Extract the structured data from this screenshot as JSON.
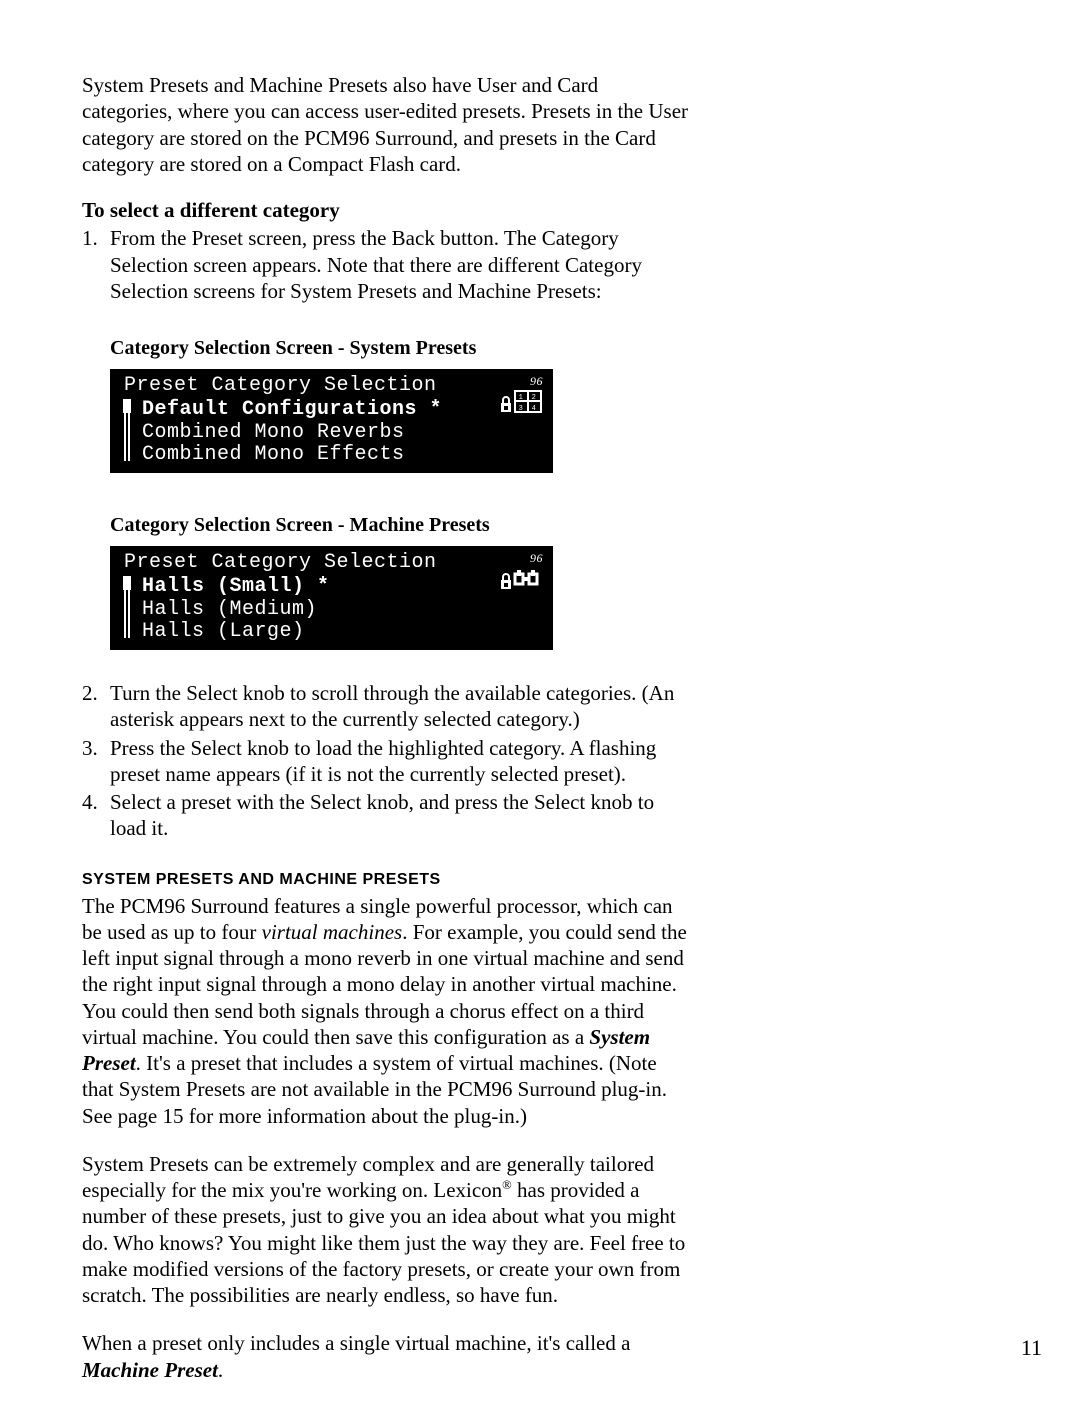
{
  "intro": "System Presets and Machine Presets also have User and Card categories, where you can access user-edited presets. Presets in the User category are stored on the PCM96 Surround, and presets in the Card category are stored on a Compact Flash card.",
  "select_heading": "To select a different category",
  "step1": "From the Preset screen, press the Back button. The Category Selection screen appears. Note that there are different Category Selection screens for System Presets and Machine Presets:",
  "label_screen1": "Category Selection Screen - System Presets",
  "lcd1": {
    "title": "Preset Category Selection",
    "row1": "Default Configurations *",
    "row2": "Combined Mono Reverbs",
    "row3": "Combined Mono Effects",
    "corner_num": "96"
  },
  "label_screen2": "Category Selection Screen - Machine Presets",
  "lcd2": {
    "title": "Preset Category Selection",
    "row1": "Halls (Small) *",
    "row2": "Halls (Medium)",
    "row3": "Halls (Large)",
    "corner_num": "96"
  },
  "step2": "Turn the Select knob to scroll through the available categories. (An asterisk appears next to the currently selected category.)",
  "step3": "Press the Select knob to load the highlighted category. A flashing preset name appears (if it is not the currently selected preset).",
  "step4": "Select a preset with the Select knob, and press the Select knob to load it.",
  "section_title": "SYSTEM PRESETS AND MACHINE PRESETS",
  "body1_a": "The PCM96 Surround features a single powerful processor, which can be used as up to four ",
  "body1_ital": "virtual machines",
  "body1_b": ". For example, you could send the left input signal through a mono reverb in one virtual machine and send the right input signal through a mono delay in another virtual machine. You could then send both signals through a chorus effect on a third virtual machine. You could then save this configuration as a ",
  "body1_bold": "System Preset",
  "body1_c": ". It's a preset that includes a system of virtual machines. (Note that System Presets are not available in the PCM96 Surround plug-in. See page 15 for more information about the plug-in.)",
  "body2_a": "System Presets can be extremely complex and are generally tailored especially for the mix you're working on.  Lexicon",
  "body2_reg": "®",
  "body2_b": " has provided a number of these presets, just to give you an idea about what you might do.  Who knows?  You might like them just the way they are.  Feel free to make modified versions of the factory presets, or create your own from scratch.  The possibilities are nearly endless, so have fun.",
  "body3_a": "When a preset only includes a single virtual machine, it's called a ",
  "body3_bold": "Machine Preset",
  "body3_b": ".",
  "page_number": "11",
  "nums": {
    "n1": "1.",
    "n2": "2.",
    "n3": "3.",
    "n4": "4."
  }
}
